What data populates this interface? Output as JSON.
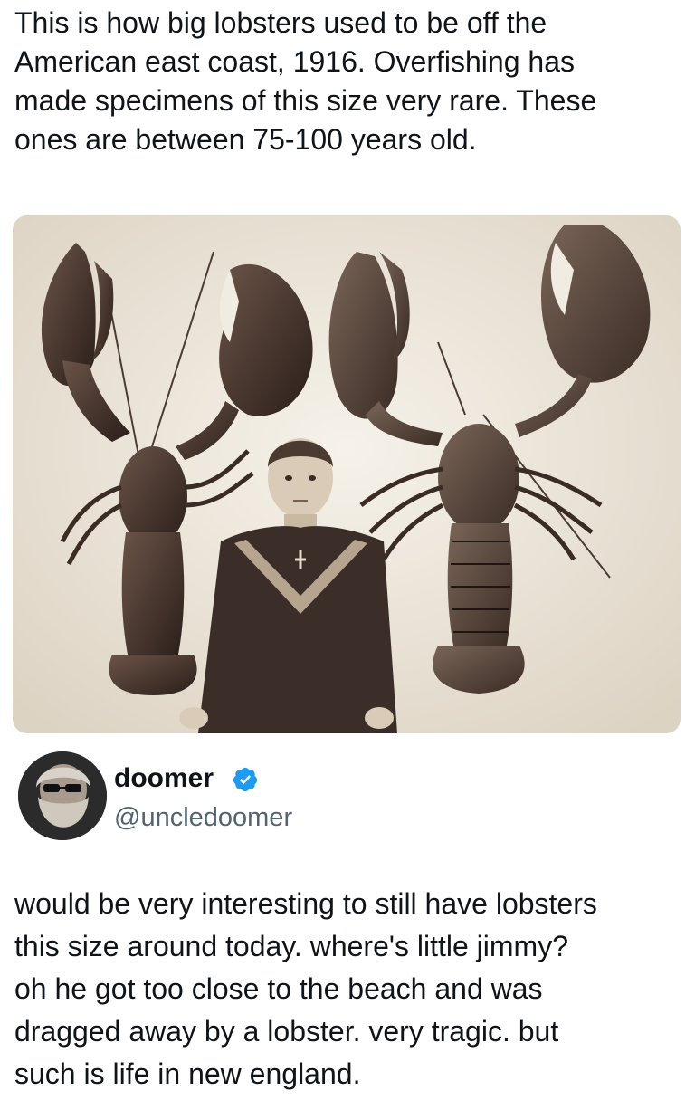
{
  "quoted_post": {
    "text": "This is how big lobsters used to be off the\nAmerican east coast, 1916. Overfishing has\nmade specimens of this size very rare. These\nones are between 75-100 years old."
  },
  "photo": {
    "description_icon": "sepia-photo-two-giant-lobsters-with-boy"
  },
  "author": {
    "display_name": "doomer",
    "handle": "@uncledoomer",
    "verified": true,
    "verified_color": "#1d9bf0"
  },
  "tweet": {
    "text": "would be very interesting to still have lobsters\nthis size around today. where's little jimmy?\noh he got too close to the beach and was\ndragged away by a lobster. very tragic. but\nsuch is life in new england."
  }
}
